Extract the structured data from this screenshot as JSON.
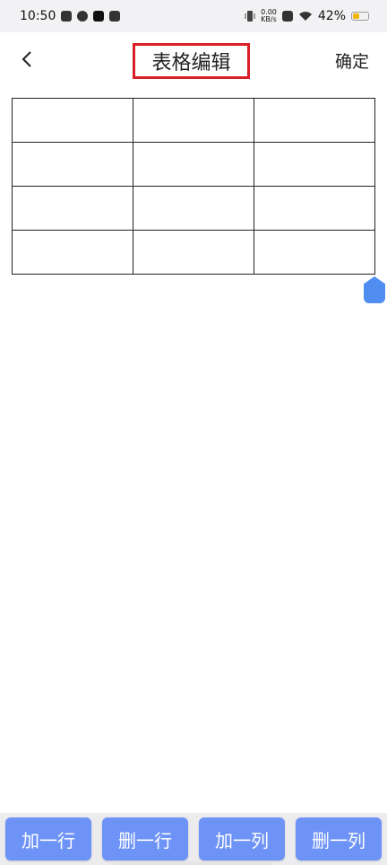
{
  "status_bar": {
    "time": "10:50",
    "net_speed_value": "0.00",
    "net_speed_unit": "KB/s",
    "battery": "42%",
    "battery_level": 0.42,
    "notification_icons": [
      "inbox-icon",
      "sync-icon",
      "tiktok-icon",
      "mail-icon"
    ],
    "system_icons": [
      "vibrate-icon",
      "close-box-icon",
      "wifi-icon",
      "battery-icon"
    ]
  },
  "header": {
    "back_icon": "chevron-left-icon",
    "title": "表格编辑",
    "confirm_label": "确定"
  },
  "table": {
    "rows": 4,
    "columns": 3,
    "cells": [
      [
        "",
        "",
        ""
      ],
      [
        "",
        "",
        ""
      ],
      [
        "",
        "",
        ""
      ],
      [
        "",
        "",
        ""
      ]
    ]
  },
  "actions": {
    "add_row": "加一行",
    "delete_row": "删一行",
    "add_column": "加一列",
    "delete_column": "删一列"
  },
  "colors": {
    "accent": "#6e93f6",
    "handle": "#4f8ef0",
    "title_highlight": "#d92027",
    "battery": "#f4b400"
  }
}
